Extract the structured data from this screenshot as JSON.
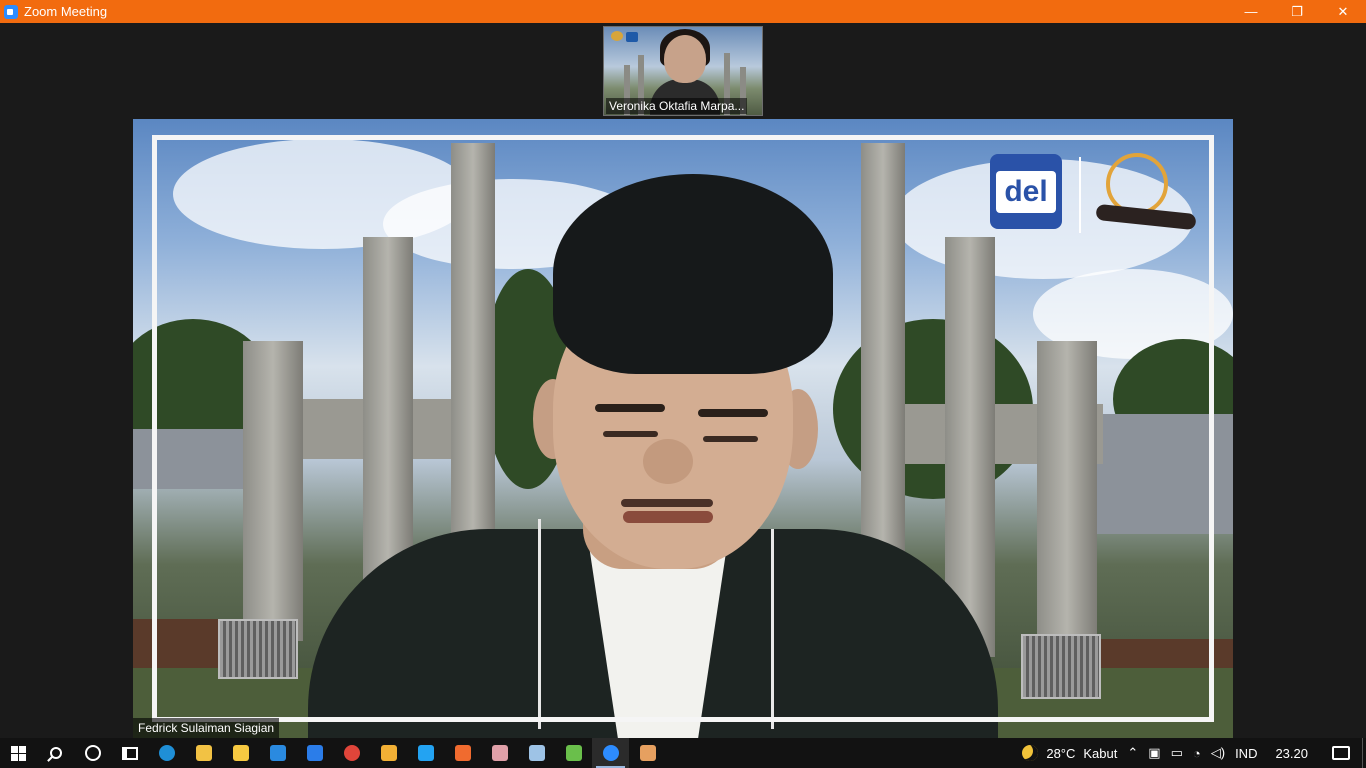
{
  "window": {
    "title": "Zoom Meeting",
    "controls": {
      "minimize": "—",
      "restore": "❐",
      "close": "✕"
    }
  },
  "meeting": {
    "thumbnail_participant": "Veronika Oktafia Marpa...",
    "speaker_name": "Fedrick Sulaiman Siagian",
    "background_logo_text": "del"
  },
  "taskbar": {
    "apps": [
      {
        "name": "start",
        "color": "#ffffff"
      },
      {
        "name": "search",
        "color": "#ffffff"
      },
      {
        "name": "cortana",
        "color": "#ffffff"
      },
      {
        "name": "task-view",
        "color": "#ffffff"
      },
      {
        "name": "edge",
        "color": "#1f8fd6"
      },
      {
        "name": "file-explorer",
        "color": "#f2c244"
      },
      {
        "name": "microsoft-store",
        "color": "#f7c941"
      },
      {
        "name": "mail",
        "color": "#2a8ae0"
      },
      {
        "name": "word-document",
        "color": "#2b7de9"
      },
      {
        "name": "chrome",
        "color": "#e0453a"
      },
      {
        "name": "git",
        "color": "#f2b035"
      },
      {
        "name": "vscode",
        "color": "#23a3f2"
      },
      {
        "name": "xampp",
        "color": "#f06b2f"
      },
      {
        "name": "app-red",
        "color": "#e0a0a8"
      },
      {
        "name": "notepad",
        "color": "#9ec3e6"
      },
      {
        "name": "android-studio",
        "color": "#6abf4b"
      },
      {
        "name": "zoom",
        "color": "#2d8cff"
      },
      {
        "name": "app-orange",
        "color": "#e6a060"
      }
    ],
    "active_app": "zoom",
    "tray": {
      "temperature": "28°C",
      "weather": "Kabut",
      "language": "IND",
      "time": "23.20"
    }
  }
}
